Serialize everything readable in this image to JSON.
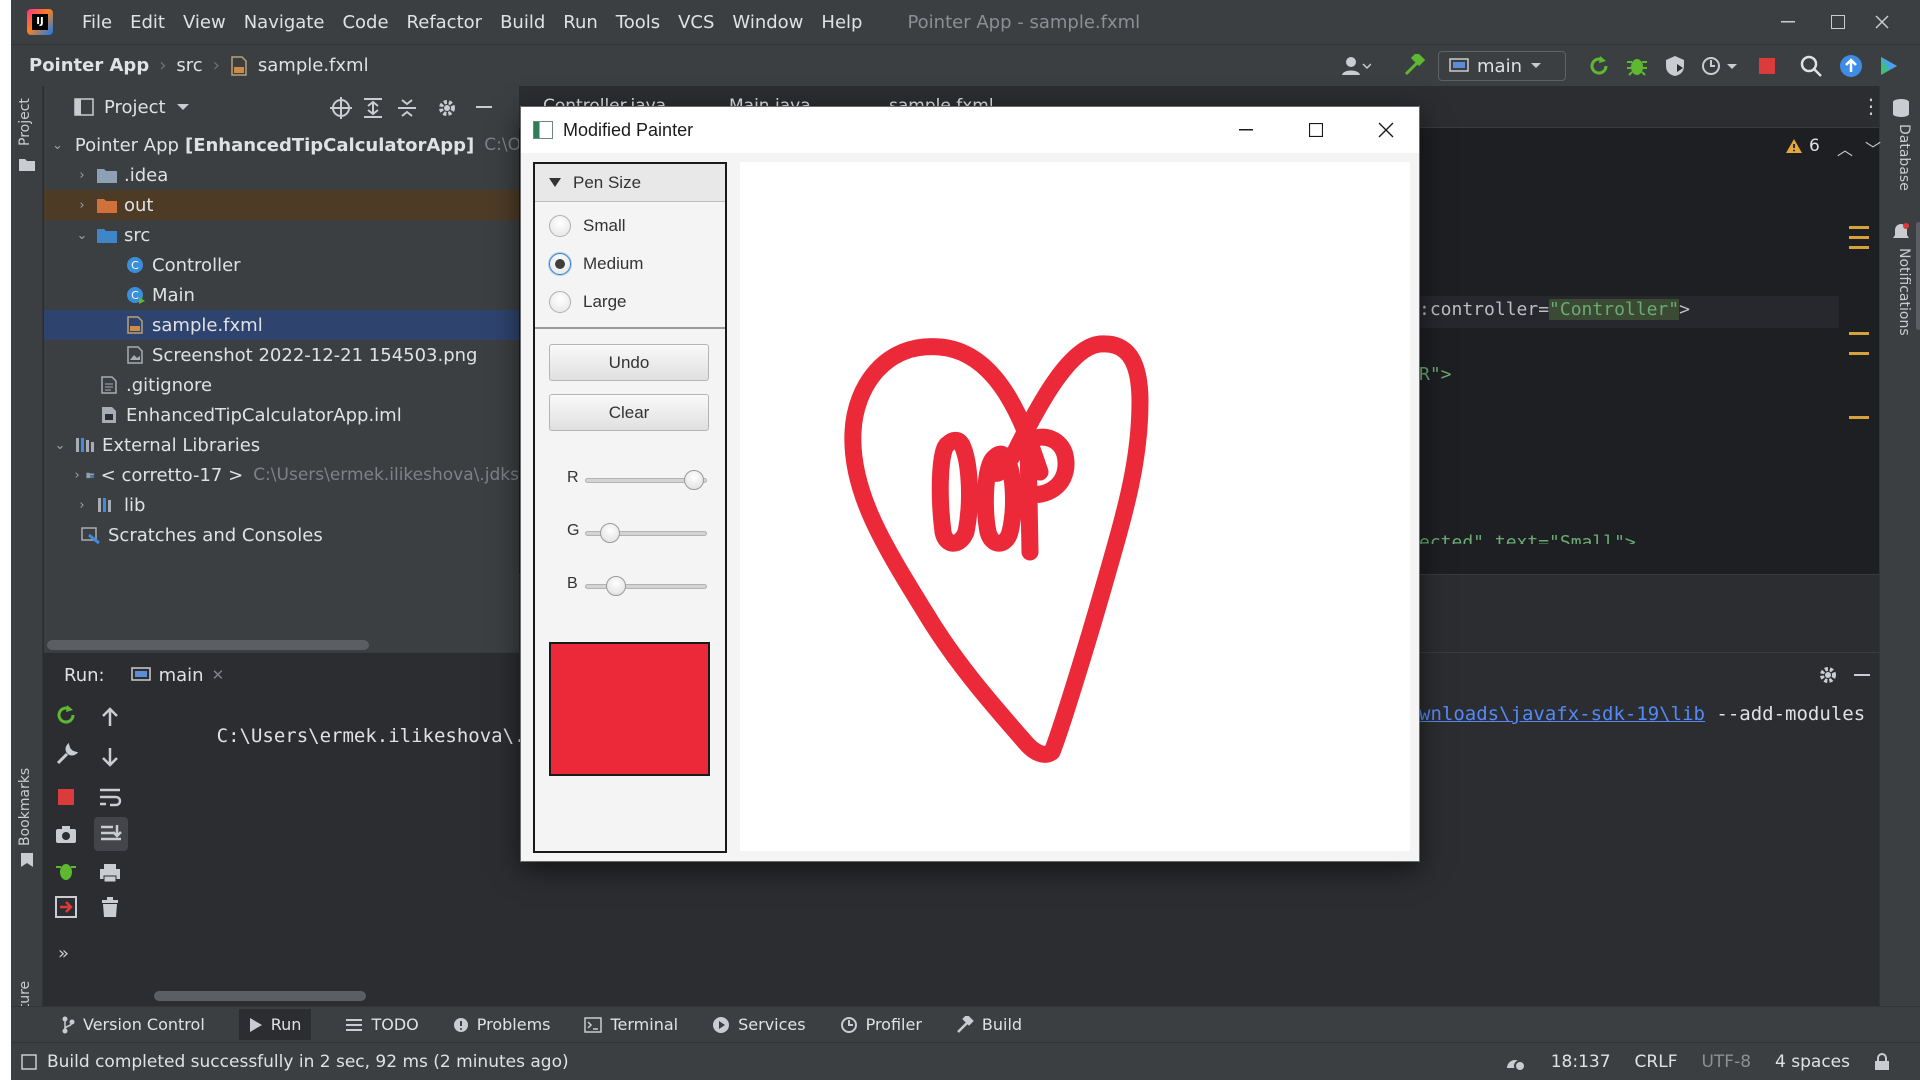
{
  "ide": {
    "menu": [
      "File",
      "Edit",
      "View",
      "Navigate",
      "Code",
      "Refactor",
      "Build",
      "Run",
      "Tools",
      "VCS",
      "Window",
      "Help"
    ],
    "window_title": "Pointer App - sample.fxml",
    "breadcrumb": {
      "project": "Pointer App",
      "folder": "src",
      "file": "sample.fxml"
    },
    "branch": "main",
    "left_stripe": {
      "project": "Project",
      "bookmarks": "Bookmarks",
      "structure": "Structure"
    },
    "right_stripe": {
      "database": "Database",
      "notifications": "Notifications"
    },
    "project_panel": {
      "title": "Project",
      "tree": [
        {
          "label": "Pointer App",
          "bold": "[EnhancedTipCalculatorApp]",
          "hint": "C:\\OO"
        },
        {
          "label": ".idea"
        },
        {
          "label": "out"
        },
        {
          "label": "src"
        },
        {
          "label": "Controller"
        },
        {
          "label": "Main"
        },
        {
          "label": "sample.fxml"
        },
        {
          "label": "Screenshot 2022-12-21 154503.png"
        },
        {
          "label": ".gitignore"
        },
        {
          "label": "EnhancedTipCalculatorApp.iml"
        },
        {
          "label": "External Libraries"
        },
        {
          "label": "< corretto-17 >",
          "hint": "C:\\Users\\ermek.ilikeshova\\.jdks"
        },
        {
          "label": "lib"
        },
        {
          "label": "Scratches and Consoles"
        }
      ]
    },
    "editor": {
      "tabs": [
        "Controller.java",
        "Main.java",
        "sample.fxml"
      ],
      "warnings": "6",
      "line1": {
        "attr": ":controller=",
        "value": "\"Controller\"",
        "end": ">"
      },
      "line2": "R\">",
      "line3": "ected\" text=\"Small\">"
    },
    "run_panel": {
      "label": "Run:",
      "tab": "main",
      "console_left": "C:\\Users\\ermek.ilikeshova\\.jdk",
      "console_link": "wnloads\\javafx-sdk-19\\lib",
      "console_right": " --add-modules"
    },
    "bottom_tools": [
      "Version Control",
      "Run",
      "TODO",
      "Problems",
      "Terminal",
      "Services",
      "Profiler",
      "Build"
    ],
    "status": {
      "message": "Build completed successfully in 2 sec, 92 ms (2 minutes ago)",
      "position": "18:137",
      "line_sep": "CRLF",
      "encoding": "UTF-8",
      "indent": "4 spaces"
    }
  },
  "painter": {
    "title": "Modified Painter",
    "pen_size": {
      "header": "Pen Size",
      "options": [
        "Small",
        "Medium",
        "Large"
      ],
      "selected": "Medium"
    },
    "buttons": {
      "undo": "Undo",
      "clear": "Clear"
    },
    "sliders": [
      {
        "label": "R",
        "value": 0.9
      },
      {
        "label": "G",
        "value": 0.2
      },
      {
        "label": "B",
        "value": 0.25
      }
    ],
    "color": "#ec2939",
    "drawing": {
      "text": "OOP",
      "stroke_color": "#ec2939"
    }
  },
  "colors": {
    "accent_red": "#ec2939",
    "selection": "#2e436e",
    "link": "#548af7",
    "string_green": "#6aab73"
  }
}
